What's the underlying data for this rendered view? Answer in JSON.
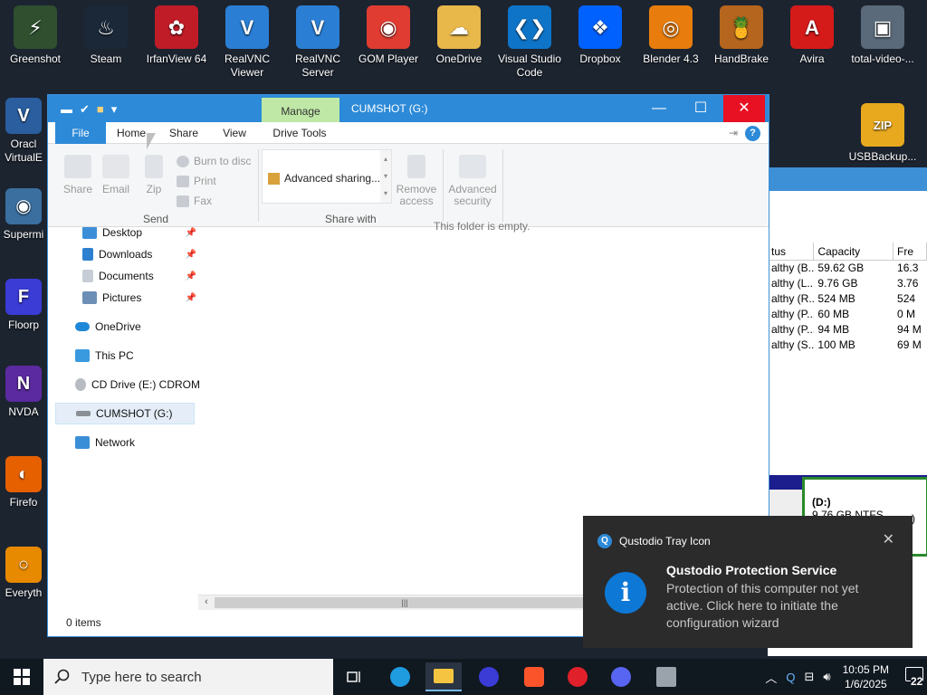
{
  "desktop": {
    "icons": [
      {
        "label": "Greenshot",
        "color": "#2f4f2f",
        "glyph": "⚡"
      },
      {
        "label": "Steam",
        "color": "#1b2838",
        "glyph": "♨"
      },
      {
        "label": "IrfanView 64",
        "color": "#c01c28",
        "glyph": "✿"
      },
      {
        "label": "RealVNC Viewer",
        "color": "#2a7fd4",
        "glyph": "V"
      },
      {
        "label": "RealVNC Server",
        "color": "#2a7fd4",
        "glyph": "V"
      },
      {
        "label": "GOM Player",
        "color": "#e03c31",
        "glyph": "◉"
      },
      {
        "label": "OneDrive",
        "color": "#e8b84a",
        "glyph": "☁"
      },
      {
        "label": "Visual Studio Code",
        "color": "#0e74c8",
        "glyph": "❮❯"
      },
      {
        "label": "Dropbox",
        "color": "#0061fe",
        "glyph": "❖"
      },
      {
        "label": "Blender 4.3",
        "color": "#e87d0d",
        "glyph": "◎"
      },
      {
        "label": "HandBrake",
        "color": "#b5651d",
        "glyph": "🍍"
      },
      {
        "label": "Avira",
        "color": "#d51a1a",
        "glyph": "A"
      },
      {
        "label": "total-video-...",
        "color": "#5a6a7a",
        "glyph": "▣"
      }
    ],
    "left_icons": [
      {
        "label": "Oracl VirtualE",
        "color": "#2a5e9e",
        "glyph": "V"
      },
      {
        "label": "Supermi",
        "color": "#3a6fa0",
        "glyph": "◉"
      },
      {
        "label": "Floorp",
        "color": "#3b3bd6",
        "glyph": "F"
      },
      {
        "label": "NVDA",
        "color": "#5b2aa0",
        "glyph": "N"
      },
      {
        "label": "Firefo",
        "color": "#e66000",
        "glyph": "◐"
      },
      {
        "label": "Everyth",
        "color": "#e88a00",
        "glyph": "○"
      }
    ],
    "usb_backup": {
      "label": "USBBackup...",
      "badge": "ZIP"
    }
  },
  "disk_mgmt": {
    "headers": [
      "tus",
      "Capacity",
      "Fre"
    ],
    "rows": [
      [
        "althy (B...",
        "59.62 GB",
        "16.3"
      ],
      [
        "althy (L...",
        "9.76 GB",
        "3.76"
      ],
      [
        "althy (R...",
        "524 MB",
        "524"
      ],
      [
        "althy (P...",
        "60 MB",
        "0 M"
      ],
      [
        "althy (P...",
        "94 MB",
        "94 M"
      ],
      [
        "althy (S...",
        "100 MB",
        "69 M"
      ]
    ],
    "partition": {
      "name": "(D:)",
      "detail": "9.76 GB NTFS",
      "extra": "e)"
    }
  },
  "explorer": {
    "title": "CUMSHOT (G:)",
    "manage_label": "Manage",
    "tabs": {
      "file": "File",
      "home": "Home",
      "share": "Share",
      "view": "View",
      "drive_tools": "Drive Tools"
    },
    "ribbon": {
      "share": "Share",
      "email": "Email",
      "zip": "Zip",
      "burn": "Burn to disc",
      "print": "Print",
      "fax": "Fax",
      "send_group": "Send",
      "advanced_sharing": "Advanced sharing...",
      "remove_access": "Remove access",
      "advanced_security": "Advanced security",
      "share_with_group": "Share with"
    },
    "nav": {
      "desktop": "Desktop",
      "downloads": "Downloads",
      "documents": "Documents",
      "pictures": "Pictures",
      "onedrive": "OneDrive",
      "this_pc": "This PC",
      "cd_drive": "CD Drive (E:) CDROM",
      "cumshot": "CUMSHOT (G:)",
      "network": "Network"
    },
    "empty_message": "This folder is empty.",
    "status": "0 items"
  },
  "toast": {
    "app": "Qustodio Tray Icon",
    "title": "Qustodio Protection Service",
    "body": "Protection of this computer not yet active. Click here to initiate the configuration wizard"
  },
  "taskbar": {
    "search_placeholder": "Type here to search",
    "time": "10:05 PM",
    "date": "1/6/2025",
    "notification_count": "22"
  }
}
